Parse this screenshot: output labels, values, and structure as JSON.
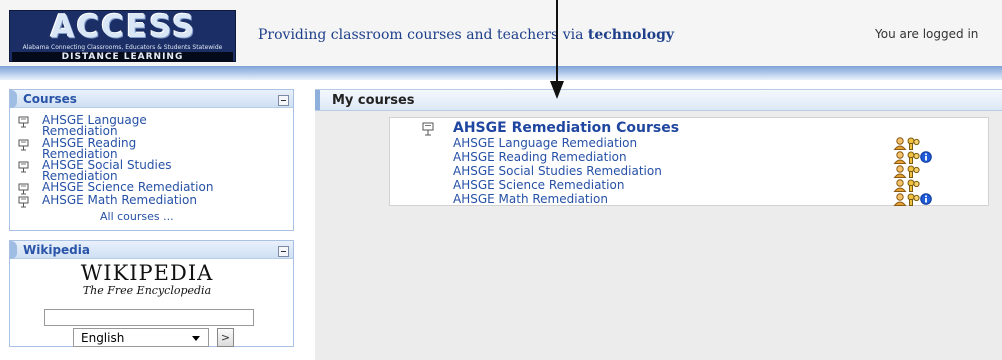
{
  "header": {
    "logo": {
      "wordmark": "ACCESS",
      "tagline_small": "Alabama Connecting Classrooms, Educators & Students Statewide",
      "subtitle": "DISTANCE LEARNING"
    },
    "tagline_prefix": "Providing classroom courses and teachers via ",
    "tagline_bold": "technology",
    "login_info": "You are logged in"
  },
  "sidebar": {
    "courses_block": {
      "title": "Courses",
      "courses": [
        {
          "label_line1": "AHSGE Language",
          "label_line2": "Remediation"
        },
        {
          "label_line1": "AHSGE Reading",
          "label_line2": "Remediation"
        },
        {
          "label_line1": "AHSGE Social Studies",
          "label_line2": "Remediation"
        },
        {
          "label_line1": "AHSGE Science Remediation",
          "label_line2": ""
        },
        {
          "label_line1": "AHSGE Math Remediation",
          "label_line2": ""
        }
      ],
      "all_courses": "All courses ..."
    },
    "wikipedia_block": {
      "title": "Wikipedia",
      "wiki_name": "WIKIPEDIA",
      "wiki_motto": "The Free Encyclopedia",
      "search_value": "",
      "language": "English",
      "go_label": ">"
    }
  },
  "main": {
    "title": "My courses",
    "category": {
      "title": "AHSGE Remediation Courses",
      "courses": [
        {
          "name": "AHSGE Language Remediation",
          "info": false
        },
        {
          "name": "AHSGE Reading Remediation",
          "info": true
        },
        {
          "name": "AHSGE Social Studies Remediation",
          "info": false
        },
        {
          "name": "AHSGE Science Remediation",
          "info": false
        },
        {
          "name": "AHSGE Math Remediation",
          "info": true
        }
      ]
    }
  },
  "colors": {
    "link": "#2651a6",
    "block_title": "#2a54a8",
    "header_band": "#7fa3d6",
    "logo_bg": "#1b2f66"
  },
  "icons": {
    "course_icon": "course-doc-icon",
    "teacher_icon": "teacher-icon",
    "guest_icon": "guest-key-icon",
    "info_icon": "info-icon",
    "collapse_icon": "collapse-icon"
  }
}
